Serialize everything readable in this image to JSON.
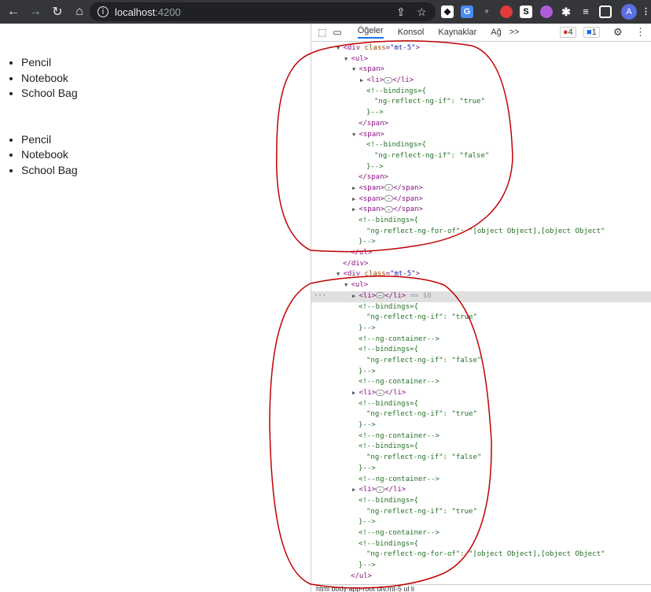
{
  "browser": {
    "url_host": "localhost",
    "url_port": ":4200",
    "icons": [
      "back-icon",
      "forward-icon",
      "reload-icon",
      "home-icon",
      "info-icon",
      "share-icon",
      "star-icon"
    ],
    "extensions": [
      "ext-1",
      "ext-translate",
      "ext-plug",
      "ext-red",
      "ext-s",
      "ext-brain",
      "puzzle-icon",
      "media-icon",
      "sidebar-icon"
    ],
    "ext_s_label": "S",
    "profile_initial": "A"
  },
  "page": {
    "list1": [
      "Pencil",
      "Notebook",
      "School Bag"
    ],
    "list2": [
      "Pencil",
      "Notebook",
      "School Bag"
    ]
  },
  "devtools": {
    "tabs": [
      "Öğeler",
      "Konsol",
      "Kaynaklar",
      "Ağ"
    ],
    "more": ">>",
    "errors": "4",
    "messages": "1",
    "breadcrumb": "html   body   app-root   div.mt-5   ul   li",
    "dom": [
      {
        "i": 0,
        "t": "▼",
        "h": "<div class=\"mt-5\">"
      },
      {
        "i": 1,
        "t": "▼",
        "h": "<ul>"
      },
      {
        "i": 2,
        "t": "▼",
        "h": "<span>"
      },
      {
        "i": 3,
        "t": "▶",
        "h": "<li>…</li>"
      },
      {
        "i": 3,
        "c": "<!--bindings={"
      },
      {
        "i": 4,
        "c": "\"ng-reflect-ng-if\": \"true\""
      },
      {
        "i": 3,
        "c": "}-->"
      },
      {
        "i": 2,
        "h": "</span>"
      },
      {
        "i": 2,
        "t": "▼",
        "h": "<span>"
      },
      {
        "i": 3,
        "c": "<!--bindings={"
      },
      {
        "i": 4,
        "c": "\"ng-reflect-ng-if\": \"false\""
      },
      {
        "i": 3,
        "c": "}-->"
      },
      {
        "i": 2,
        "h": "</span>"
      },
      {
        "i": 2,
        "t": "▶",
        "h": "<span>…</span>"
      },
      {
        "i": 2,
        "t": "▶",
        "h": "<span>…</span>"
      },
      {
        "i": 2,
        "t": "▶",
        "h": "<span>…</span>"
      },
      {
        "i": 2,
        "c": "<!--bindings={"
      },
      {
        "i": 3,
        "c": "\"ng-reflect-ng-for-of\": \"[object Object],[object Object\""
      },
      {
        "i": 2,
        "c": "}-->"
      },
      {
        "i": 1,
        "h": "</ul>"
      },
      {
        "i": 0,
        "h": "</div>"
      },
      {
        "i": 0,
        "t": "▼",
        "h": "<div class=\"mt-5\">"
      },
      {
        "i": 1,
        "t": "▼",
        "h": "<ul>"
      },
      {
        "i": 2,
        "t": "▶",
        "h": "<li>…</li>",
        "sel": true,
        "eq": " == $0"
      },
      {
        "i": 2,
        "c": "<!--bindings={"
      },
      {
        "i": 3,
        "c": "\"ng-reflect-ng-if\": \"true\""
      },
      {
        "i": 2,
        "c": "}-->"
      },
      {
        "i": 2,
        "c": "<!--ng-container-->"
      },
      {
        "i": 2,
        "c": "<!--bindings={"
      },
      {
        "i": 3,
        "c": "\"ng-reflect-ng-if\": \"false\""
      },
      {
        "i": 2,
        "c": "}-->"
      },
      {
        "i": 2,
        "c": "<!--ng-container-->"
      },
      {
        "i": 2,
        "t": "▶",
        "h": "<li>…</li>"
      },
      {
        "i": 2,
        "c": "<!--bindings={"
      },
      {
        "i": 3,
        "c": "\"ng-reflect-ng-if\": \"true\""
      },
      {
        "i": 2,
        "c": "}-->"
      },
      {
        "i": 2,
        "c": "<!--ng-container-->"
      },
      {
        "i": 2,
        "c": "<!--bindings={"
      },
      {
        "i": 3,
        "c": "\"ng-reflect-ng-if\": \"false\""
      },
      {
        "i": 2,
        "c": "}-->"
      },
      {
        "i": 2,
        "c": "<!--ng-container-->"
      },
      {
        "i": 2,
        "t": "▶",
        "h": "<li>…</li>"
      },
      {
        "i": 2,
        "c": "<!--bindings={"
      },
      {
        "i": 3,
        "c": "\"ng-reflect-ng-if\": \"true\""
      },
      {
        "i": 2,
        "c": "}-->"
      },
      {
        "i": 2,
        "c": "<!--ng-container-->"
      },
      {
        "i": 2,
        "c": "<!--bindings={"
      },
      {
        "i": 3,
        "c": "\"ng-reflect-ng-for-of\": \"[object Object],[object Object\""
      },
      {
        "i": 2,
        "c": "}-->"
      },
      {
        "i": 1,
        "h": "</ul>"
      }
    ]
  },
  "annotation_color": "#c00000"
}
